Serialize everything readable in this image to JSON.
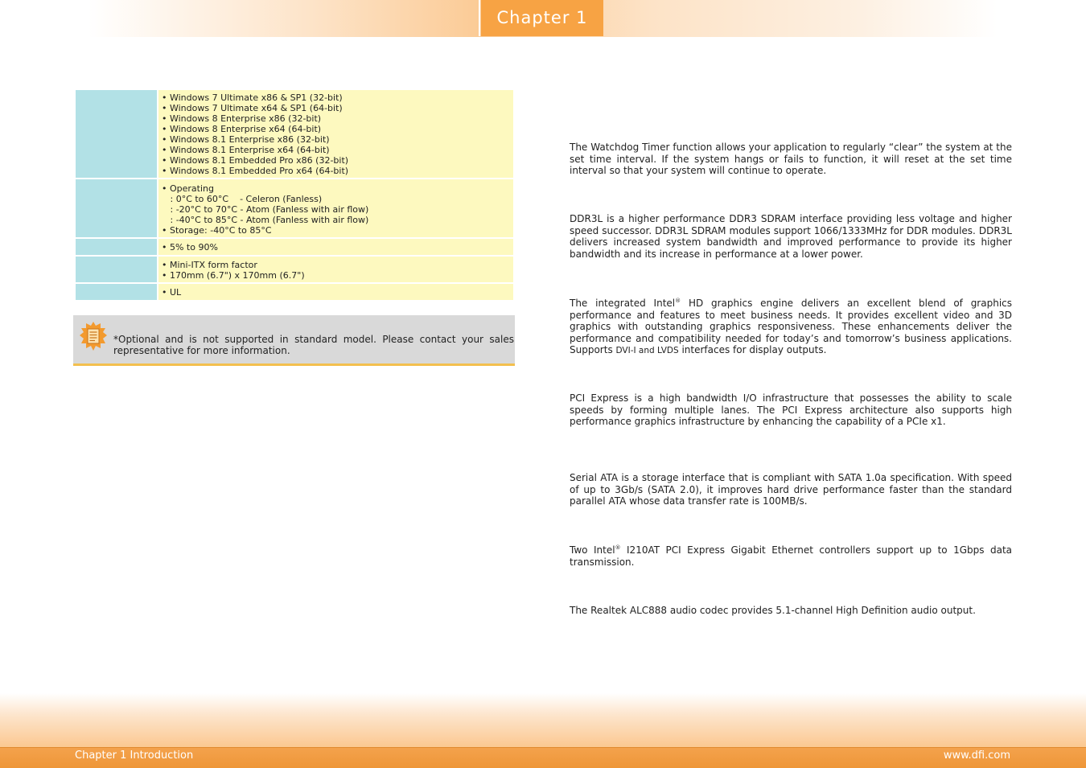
{
  "header": {
    "chapter_tab": "Chapter 1"
  },
  "spec_table": {
    "rows": [
      {
        "lines": [
          "• Windows 7 Ultimate x86 & SP1 (32-bit)",
          "• Windows 7 Ultimate x64 & SP1 (64-bit)",
          "• Windows 8 Enterprise x86 (32-bit)",
          "• Windows 8 Enterprise x64 (64-bit)",
          "• Windows 8.1 Enterprise x86 (32-bit)",
          "• Windows 8.1 Enterprise x64 (64-bit)",
          "• Windows 8.1 Embedded Pro x86 (32-bit)",
          "• Windows 8.1 Embedded Pro x64 (64-bit)"
        ]
      },
      {
        "lines": [
          "• Operating",
          "   : 0°C to 60°C    - Celeron (Fanless)",
          "   : -20°C to 70°C - Atom (Fanless with air flow)",
          "   : -40°C to 85°C - Atom (Fanless with air flow)",
          "• Storage: -40°C to 85°C"
        ]
      },
      {
        "lines": [
          "• 5% to 90%"
        ]
      },
      {
        "lines": [
          "• Mini-ITX form factor",
          "• 170mm (6.7\") x 170mm (6.7\")"
        ]
      },
      {
        "lines": [
          "• UL"
        ]
      }
    ]
  },
  "note": {
    "text": "*Optional and is not supported in standard model. Please contact your sales representative for more information."
  },
  "paragraphs": {
    "watchdog": "The Watchdog Timer function allows your application to regularly “clear” the system at the set time interval. If the system hangs or fails to function, it will reset at the set time interval so that your system will continue to operate.",
    "ddr3l": "DDR3L is a higher performance DDR3 SDRAM interface providing less voltage and higher speed successor. DDR3L SDRAM modules support 1066/1333MHz for DDR modules. DDR3L delivers increased system bandwidth and improved performance to provide its higher bandwidth and its increase in performance at a lower power.",
    "graphics_a": "The integrated Intel",
    "graphics_sup": "®",
    "graphics_b": " HD graphics engine delivers an excellent blend of graphics performance and features to meet business needs. It provides excellent video and 3D graphics with outstanding graphics responsiveness. These enhancements deliver the performance and compatibility needed for today’s and tomorrow’s business applications. Supports ",
    "graphics_c": "DVI-I and LVDS",
    "graphics_d": " interfaces for display outputs.",
    "pcie": "PCI Express is a high bandwidth I/O infrastructure that possesses the ability to scale speeds by forming multiple lanes. The PCI Express architecture also supports high performance graphics infrastructure by enhancing the capability of a PCIe x1.",
    "sata": "Serial ATA is a storage interface that is compliant with SATA 1.0a specification. With speed of up to 3Gb/s (SATA 2.0), it improves hard drive performance faster than the standard parallel ATA whose data transfer rate is 100MB/s.",
    "lan_a": "Two Intel",
    "lan_sup": "®",
    "lan_b": " I210AT PCI Express Gigabit Ethernet controllers support up to 1Gbps data transmission.",
    "audio": "The Realtek ALC888 audio codec provides 5.1-channel High Definition audio output."
  },
  "footer": {
    "left": "Chapter 1 Introduction",
    "right": "www.dfi.com"
  }
}
